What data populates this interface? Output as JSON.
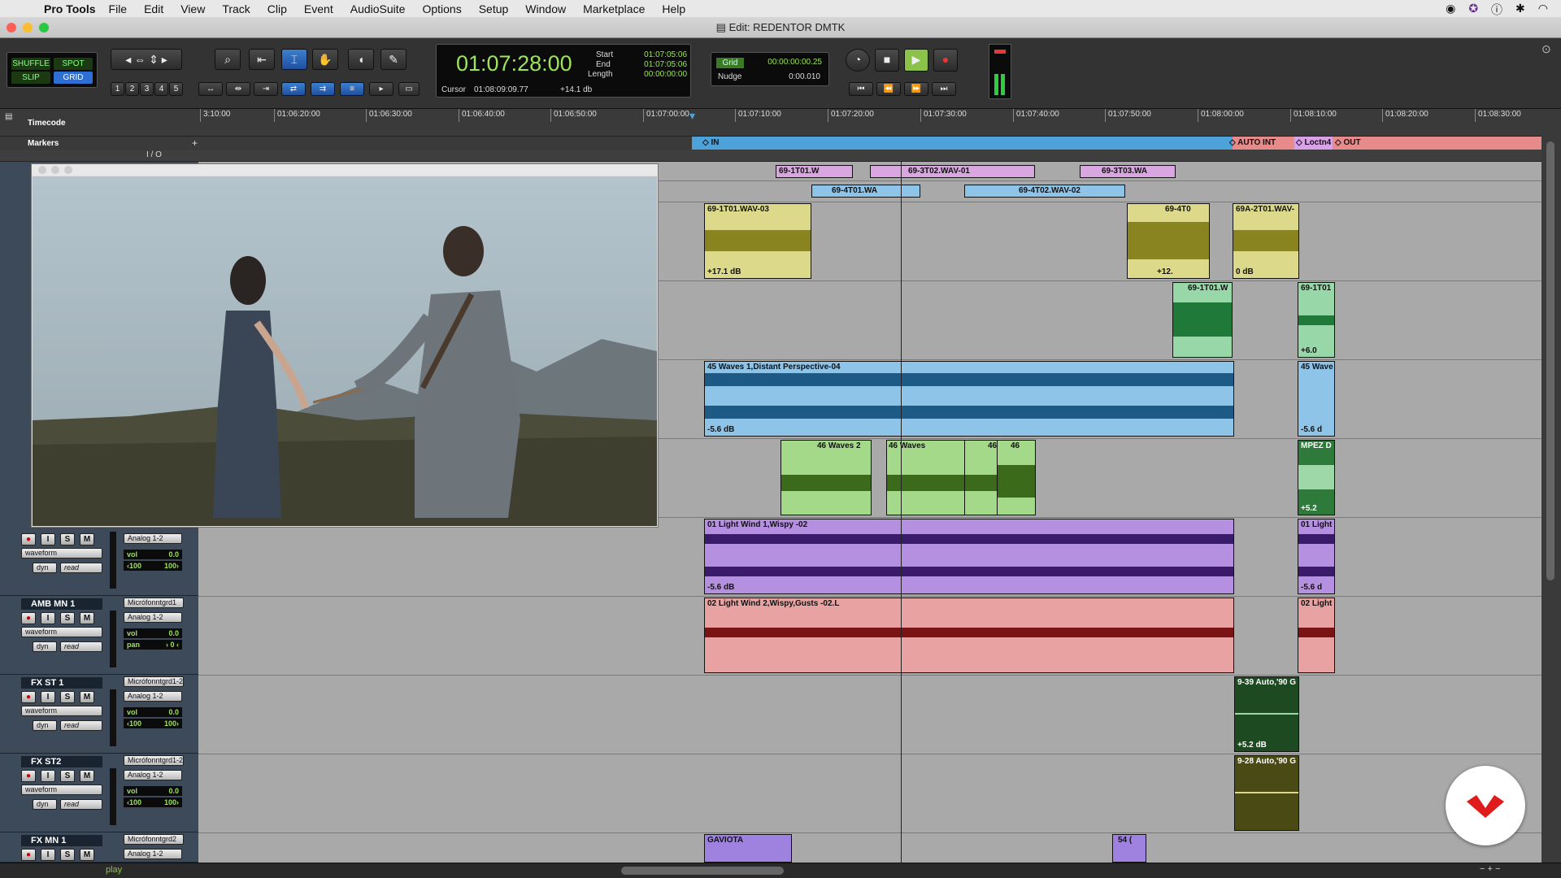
{
  "menubar": {
    "app": "Pro Tools",
    "items": [
      "File",
      "Edit",
      "View",
      "Track",
      "Clip",
      "Event",
      "AudioSuite",
      "Options",
      "Setup",
      "Window",
      "Marketplace",
      "Help"
    ]
  },
  "window": {
    "title": "Edit: REDENTOR DMTK"
  },
  "modes": {
    "shuffle": "SHUFFLE",
    "spot": "SPOT",
    "slip": "SLIP",
    "grid": "GRID"
  },
  "zoom_presets": [
    "1",
    "2",
    "3",
    "4",
    "5"
  ],
  "counter": {
    "main": "01:07:28:00",
    "start_label": "Start",
    "end_label": "End",
    "length_label": "Length",
    "start": "01:07:05:06",
    "end": "01:07:05:06",
    "length": "00:00:00:00",
    "cursor_label": "Cursor",
    "cursor": "01:08:09:09.77",
    "cursor_db": "+14.1 db"
  },
  "grid": {
    "label": "Grid",
    "value": "00:00:00:00.25",
    "nudge_label": "Nudge",
    "nudge_value": "0:00.010"
  },
  "ruler": {
    "label": "Timecode",
    "ticks": [
      "3:10:00",
      "01:06:20:00",
      "01:06:30:00",
      "01:06:40:00",
      "01:06:50:00",
      "01:07:00:00",
      "01:07:10:00",
      "01:07:20:00",
      "01:07:30:00",
      "01:07:40:00",
      "01:07:50:00",
      "01:08:00:00",
      "01:08:10:00",
      "01:08:20:00",
      "01:08:30:00"
    ]
  },
  "markers": {
    "label": "Markers",
    "in": "IN",
    "auto_int": "AUTO INT",
    "loctn": "Loctn4",
    "out": "OUT"
  },
  "io_label": "I / O",
  "tracks": [
    {
      "name": "AMB MN 1",
      "input": "Micrófonntgrd1",
      "output": "Analog 1-2",
      "view": "waveform",
      "auto": "read",
      "vol": "0.0",
      "pan_l": "pan",
      "pan_r": "0"
    },
    {
      "name": "FX ST 1",
      "input": "Micrófonntgrd1-2",
      "output": "Analog 1-2",
      "view": "waveform",
      "auto": "read",
      "vol": "0.0",
      "pan_l": "100",
      "pan_r": "100"
    },
    {
      "name": "FX ST2",
      "input": "Micrófonntgrd1-2",
      "output": "Analog 1-2",
      "view": "waveform",
      "auto": "read",
      "vol": "0.0",
      "pan_l": "100",
      "pan_r": "100"
    },
    {
      "name": "FX MN 1",
      "input": "Micrófonntgrd2",
      "output": "Analog 1-2",
      "view": "waveform",
      "auto": "read",
      "vol": "0.0",
      "pan_l": "100",
      "pan_r": "100"
    }
  ],
  "partial_track": {
    "output": "Analog 1-2",
    "view": "waveform",
    "auto": "read",
    "vol": "0.0",
    "pan_l": "100",
    "pan_r": "100"
  },
  "button_labels": {
    "input": "I",
    "solo": "S",
    "mute": "M",
    "dyn": "dyn",
    "vol": "vol"
  },
  "clips": [
    {
      "name": "69-1T01.W",
      "gain": ""
    },
    {
      "name": "69-3T02.WAV-01",
      "gain": ""
    },
    {
      "name": "69-3T03.WA",
      "gain": ""
    },
    {
      "name": "69-4T01.WA",
      "gain": ""
    },
    {
      "name": "69-4T02.WAV-02",
      "gain": ""
    },
    {
      "name": "69-1T01.WAV-03",
      "gain": "+17.1 dB"
    },
    {
      "name": "69-4T0",
      "gain": "+12."
    },
    {
      "name": "69A-2T01.WAV-",
      "gain": "0 dB"
    },
    {
      "name": "69-1T01.W",
      "gain": ""
    },
    {
      "name": "69-1T01",
      "gain": "+6.0"
    },
    {
      "name": "45 Waves 1,Distant Perspective-04",
      "gain": "-5.6 dB"
    },
    {
      "name": "45 Wave",
      "gain": "-5.6 d"
    },
    {
      "name": "46  Waves 2",
      "gain": ""
    },
    {
      "name": "46  Waves",
      "gain": ""
    },
    {
      "name": "46",
      "gain": ""
    },
    {
      "name": "46",
      "gain": ""
    },
    {
      "name": "MPEZ D",
      "gain": "+5.2"
    },
    {
      "name": "01 Light Wind 1,Wispy -02",
      "gain": "-5.6 dB"
    },
    {
      "name": "01 Light",
      "gain": "-5.6 d"
    },
    {
      "name": "02 Light Wind 2,Wispy,Gusts -02.L",
      "gain": ""
    },
    {
      "name": "02 Light",
      "gain": ""
    },
    {
      "name": "9-39 Auto,'90 G",
      "gain": "+5.2 dB"
    },
    {
      "name": "9-28 Auto,'90 G",
      "gain": ""
    },
    {
      "name": "GAVIOTA",
      "gain": ""
    },
    {
      "name": "54 (",
      "gain": ""
    }
  ],
  "status": {
    "play": "play"
  },
  "colors": {
    "counter_green": "#9de45a",
    "marker_blue": "#4da3d9",
    "marker_red": "#e68a8a",
    "logo_red": "#e01b1b"
  }
}
